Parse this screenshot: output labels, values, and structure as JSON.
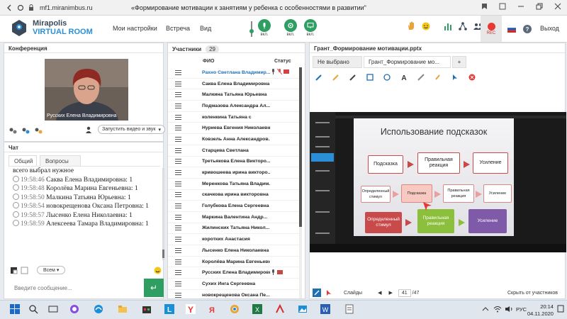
{
  "browser": {
    "url": "mf1.miranimbus.ru",
    "tab_title": "«Формирование мотивации к занятиям у ребенка с особенностями в развитии\""
  },
  "app": {
    "logo_line1": "Mirapolis",
    "logo_line2": "VIRTUAL ROOM",
    "menu": [
      "Мои настройки",
      "Встреча",
      "Вид"
    ],
    "controls": [
      "вкл.",
      "вкл.",
      "вкл."
    ],
    "rec_label": "REC",
    "exit_label": "Выход"
  },
  "conference": {
    "title": "Конференция",
    "video_name": "Русских Елена Владимировна",
    "start_select": "Запустить видео и звук"
  },
  "chat": {
    "title": "Чат",
    "tabs": [
      "Общий",
      "Вопросы"
    ],
    "messages": [
      {
        "time": "",
        "text": "всего выбрал нужное"
      },
      {
        "time": "19:58:46",
        "text": "Саква Елена Владимировна: 1"
      },
      {
        "time": "19:58:48",
        "text": "Королёва Марина Евгеньевна: 1"
      },
      {
        "time": "19:58:50",
        "text": "Малкина Татьяна Юрьевна: 1"
      },
      {
        "time": "19:58:54",
        "text": "новокрещенова Оксана Петровна: 1"
      },
      {
        "time": "19:58:57",
        "text": "Лысенко Елена Николаевна: 1"
      },
      {
        "time": "19:58:59",
        "text": "Алексеева Тамара Владимировна: 1"
      }
    ],
    "recipient": "Всем",
    "input_placeholder": "Введите сообщение..."
  },
  "participants": {
    "title": "Участники",
    "count": "29",
    "col_name": "ФИО",
    "col_status": "Статус",
    "list": [
      "Рахно Светлана Владимир...",
      "Саква Елена Владимировна",
      "Малкина Татьяна Юрьевна",
      "Подмазова Александра Ал...",
      "коленкина Татьяна с",
      "Нуриева Евгения Николаевна",
      "Ковзель Анна Александров...",
      "Старцева Светлана",
      "Третьякова Елена Викторо...",
      "кривошеева ирина викторо...",
      "Меренкова Татьяна Владим...",
      "скачкова ирина викторовна",
      "Голубкова Елена Сергеевна",
      "Маркина Валентина Андр...",
      "Жилинских Татьяна Никол...",
      "коротких Анастасия",
      "Лысенко Елена Николаевна",
      "Королёва Марина Евгеньевна",
      "Русских Елена Владимировна",
      "Сухих Инга Сергеевна",
      "новокрещенова Оксана Пе..."
    ]
  },
  "presentation": {
    "title": "Грант_Формирование мотивации.pptx",
    "tabs": [
      "Не выбрано",
      "Грант_Формирование мо...",
      "+"
    ],
    "slide_title": "Использование подсказок",
    "row1": [
      "Подсказка",
      "Правильная реакция",
      "Усиление"
    ],
    "row2": [
      "Определенный стимул",
      "Подсказка",
      "Правильная реакция",
      "Усиление"
    ],
    "row3": [
      "Определенный стимул",
      "Правильная реакция",
      "Усиление"
    ],
    "slides_label": "Слайды",
    "slide_num": "41",
    "slide_total": "/47",
    "hide_label": "Скрыть от участников"
  },
  "taskbar": {
    "lang": "РУС",
    "time": "20:14",
    "date": "04.11.2020"
  },
  "colors": {
    "accent_green": "#2e9e63",
    "rec_red": "#e53935",
    "brand_blue": "#2a8fd6"
  }
}
